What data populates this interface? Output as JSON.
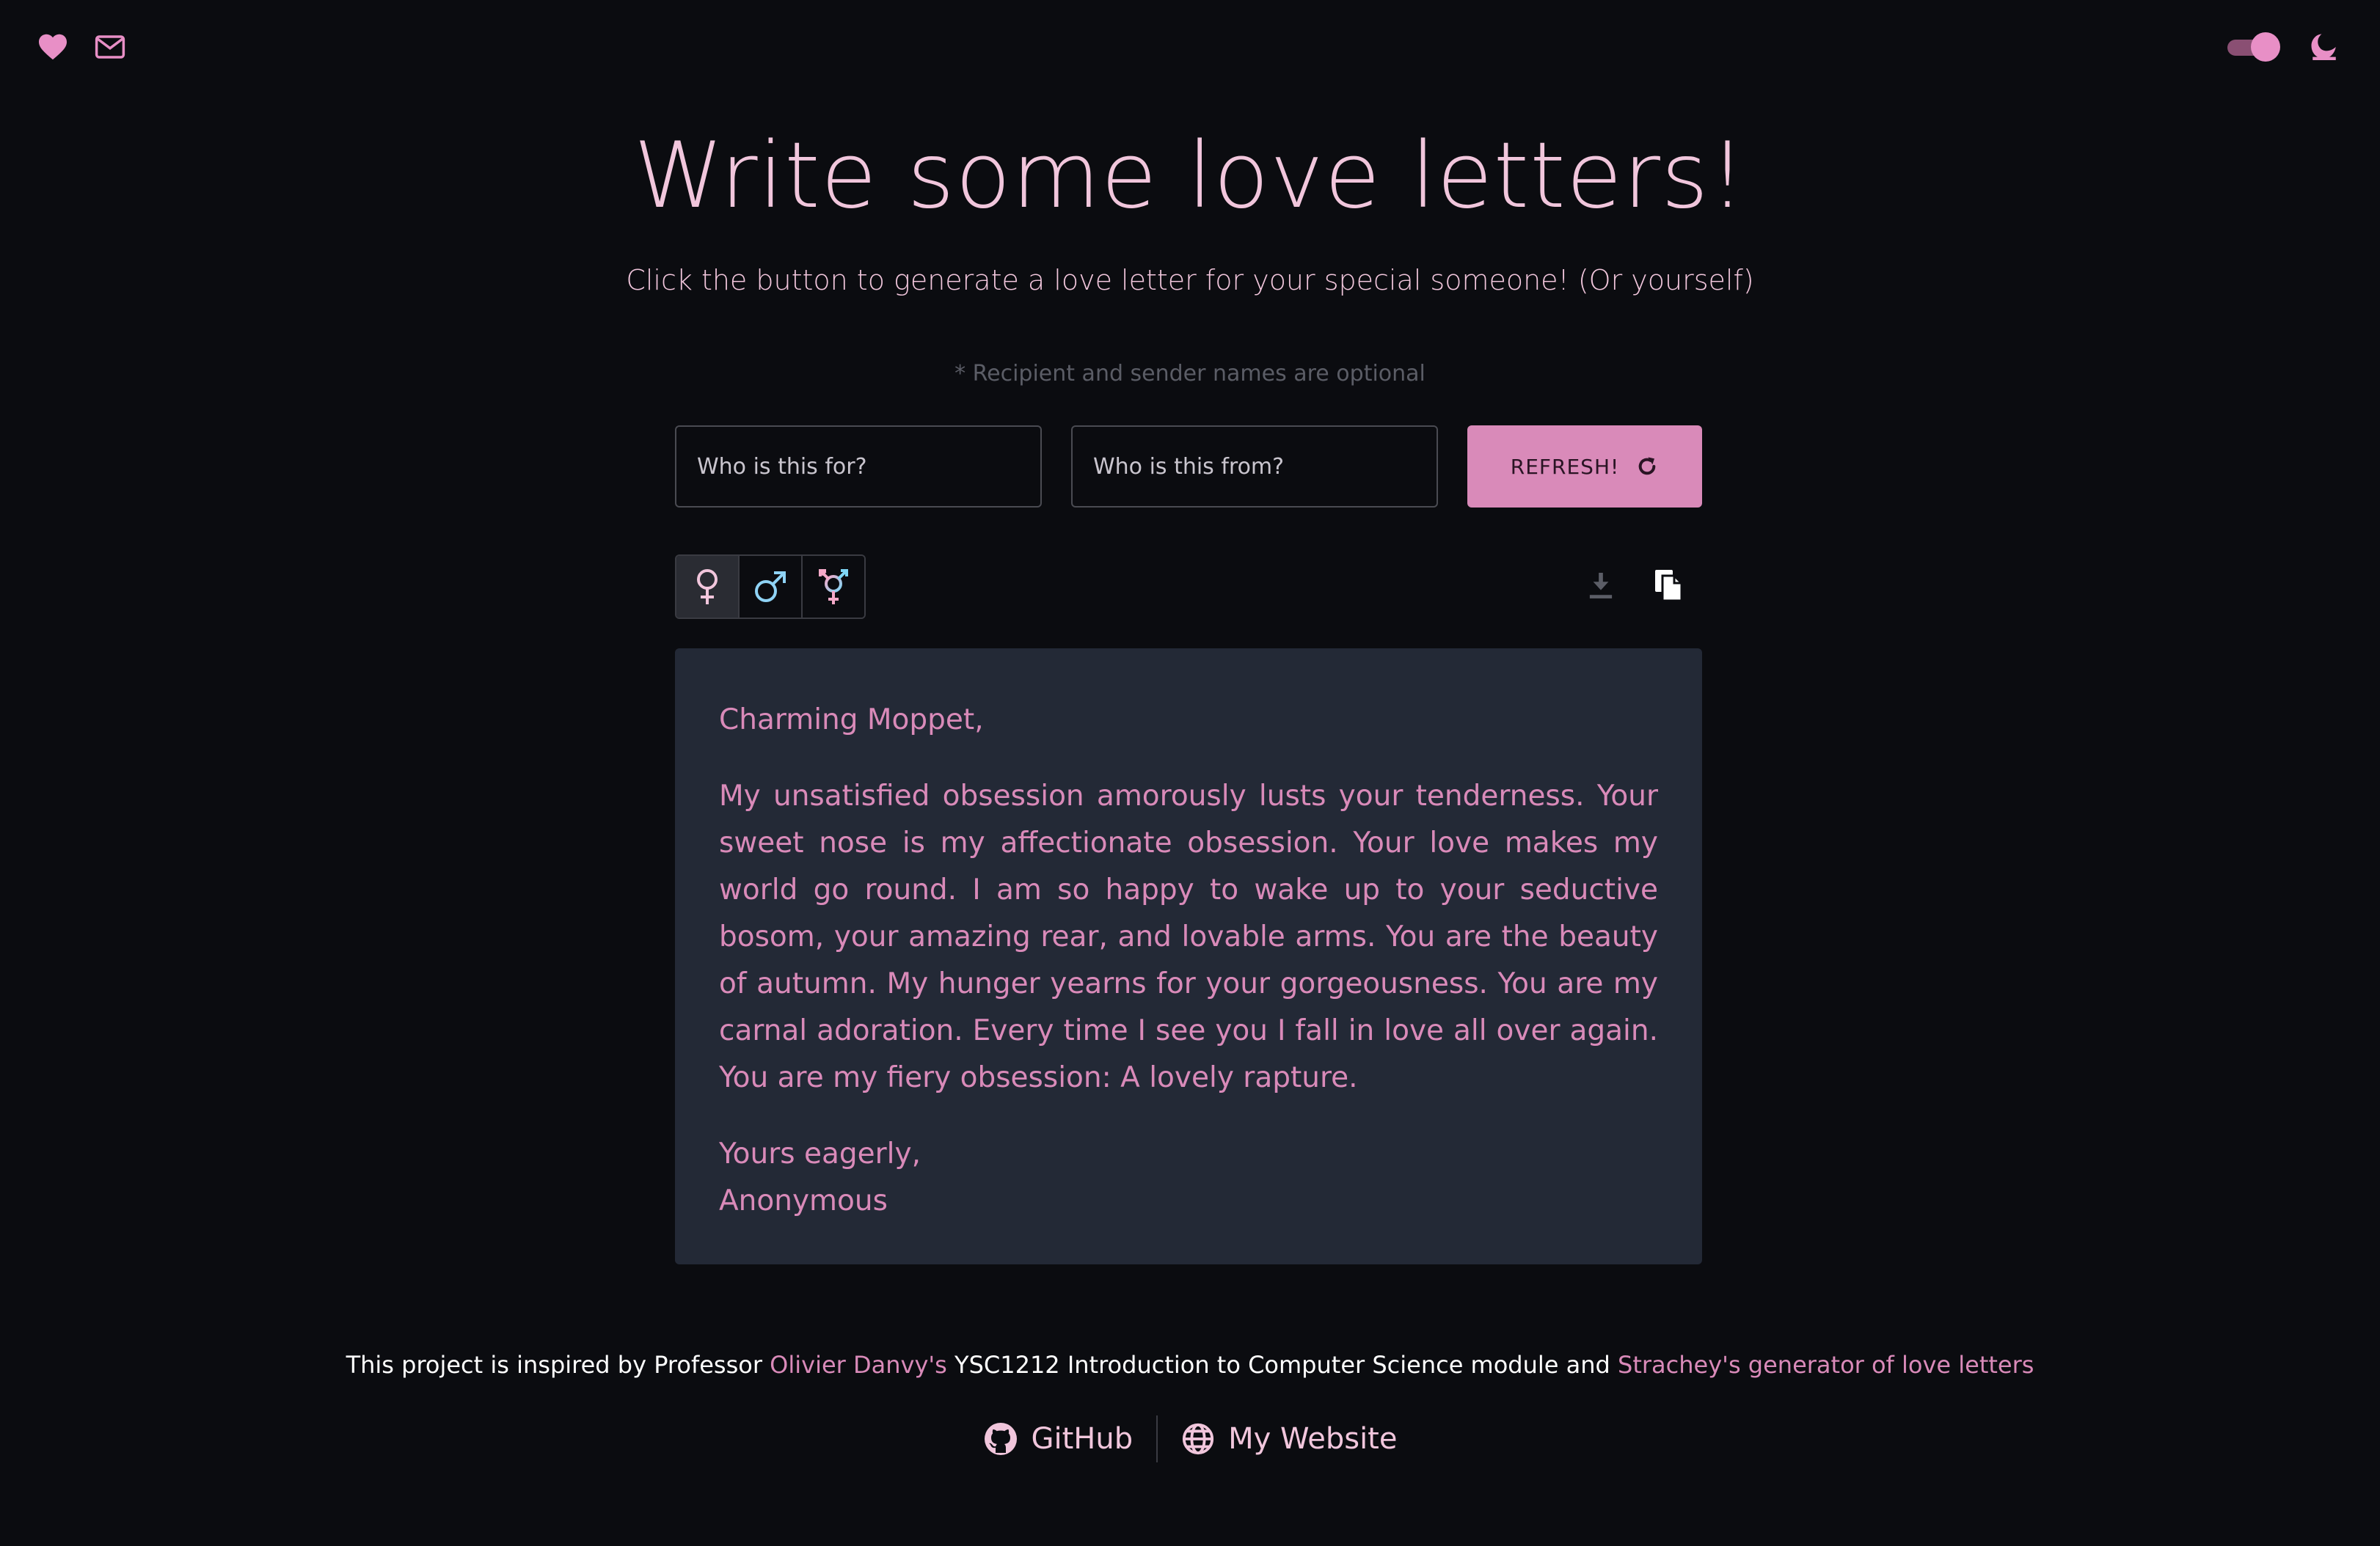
{
  "header": {
    "title": "Write some love letters!",
    "subtitle": "Click the button to generate a love letter for your special someone! (Or yourself)",
    "optional_note": "* Recipient and sender names are optional"
  },
  "form": {
    "recipient_placeholder": "Who is this for?",
    "sender_placeholder": "Who is this from?",
    "refresh_label": "REFRESH!"
  },
  "gender_options": [
    "♀",
    "♂",
    "⚧"
  ],
  "letter": {
    "greeting": "Charming Moppet,",
    "body": "My unsatisfied obsession amorously lusts your tenderness. Your sweet nose is my affectionate obsession. Your love makes my world go round. I am so happy to wake up to your seductive bosom, your amazing rear, and lovable arms. You are the beauty of autumn. My hunger yearns for your gorgeousness. You are my carnal adoration. Every time I see you I fall in love all over again. You are my fiery obsession: A lovely rapture.",
    "closing": "Yours eagerly,",
    "signature": "Anonymous"
  },
  "footer": {
    "credit_prefix": "This project is inspired by Professor ",
    "credit_link_1": "Olivier Danvy's",
    "credit_middle": " YSC1212 Introduction to Computer Science module and ",
    "credit_link_2": "Strachey's generator of love letters",
    "github_label": "GitHub",
    "website_label": "My Website"
  },
  "colors": {
    "background": "#0b0c10",
    "accent_pink": "#d98ab9",
    "light_pink": "#f1c6dc",
    "card_background": "#232936",
    "female_symbol": "#f1c6dc",
    "male_symbol": "#8fd3f5",
    "trans_symbol_gradient": [
      "#f5a9c8",
      "#7fd6f5"
    ]
  },
  "icons": {
    "heart": "heart-icon",
    "mail": "mail-icon",
    "theme_toggle": "toggle-switch",
    "moon": "moon-icon",
    "refresh": "refresh-icon",
    "download": "download-icon",
    "copy": "copy-icon",
    "github": "github-icon",
    "globe": "globe-icon"
  }
}
